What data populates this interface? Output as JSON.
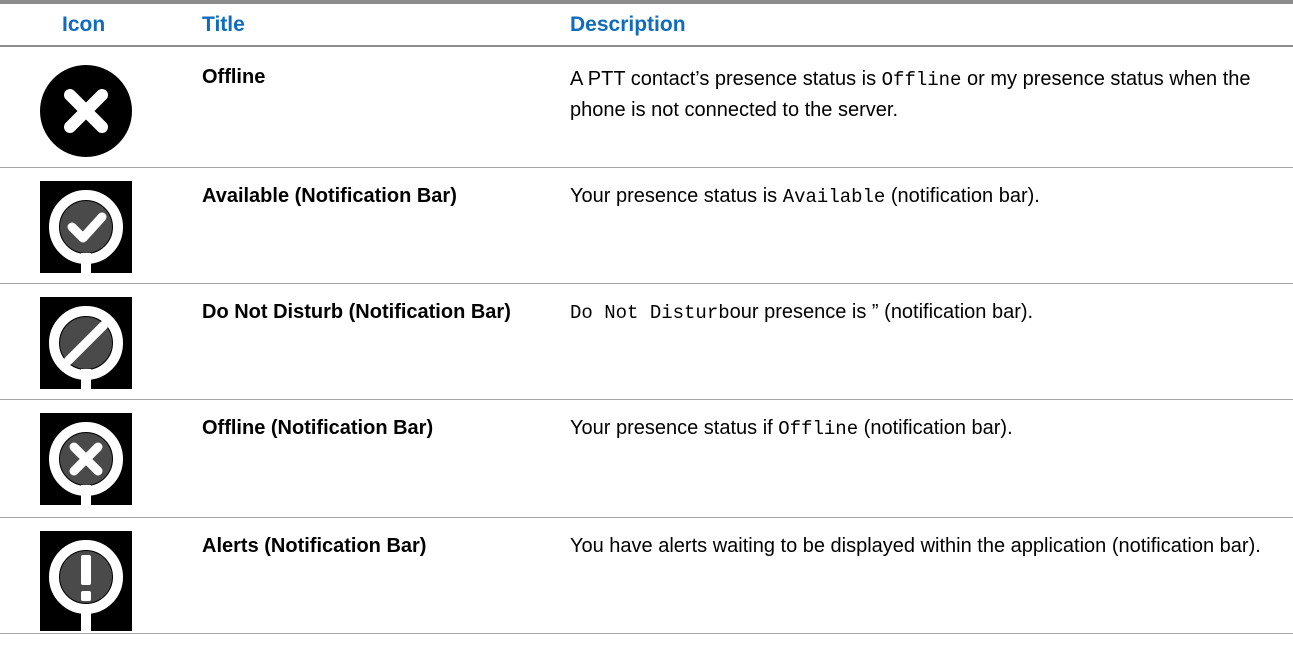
{
  "header": {
    "icon": "Icon",
    "title": "Title",
    "description": "Description"
  },
  "rows": [
    {
      "icon": "offline-x-circle-icon",
      "title": "Offline",
      "desc_pre": "A PTT contact’s presence status is ",
      "desc_code": "Offline",
      "desc_post": " or my presence status when the phone is not connected to the server."
    },
    {
      "icon": "available-check-icon",
      "title": "Available (Notification Bar)",
      "desc_pre": "Your presence status is ",
      "desc_code": "Available",
      "desc_post": " (notification bar)."
    },
    {
      "icon": "do-not-disturb-icon",
      "title": "Do Not Disturb (Notification Bar)",
      "desc_pre": "",
      "desc_code": "Do Not Disturb",
      "desc_post": "our presence is ” (notification bar)."
    },
    {
      "icon": "offline-notification-icon",
      "title": "Offline (Notification Bar)",
      "desc_pre": "Your presence status if ",
      "desc_code": "Offline",
      "desc_post": " (notification bar)."
    },
    {
      "icon": "alerts-exclamation-icon",
      "title": "Alerts (Notification Bar)",
      "desc_pre": "You have alerts waiting to be displayed within the application (notification bar).",
      "desc_code": "",
      "desc_post": ""
    }
  ]
}
